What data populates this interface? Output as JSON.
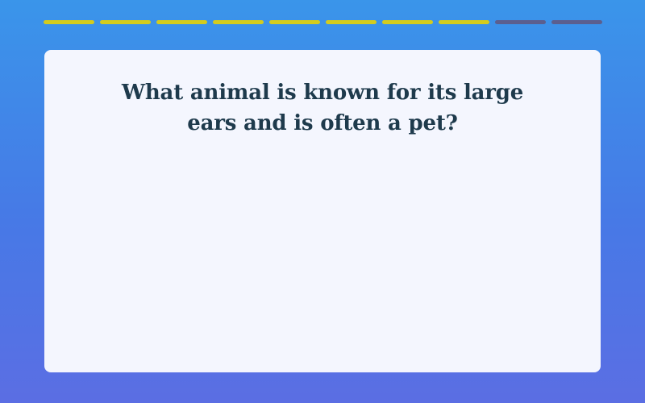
{
  "quiz": {
    "progress": {
      "total_steps": 10,
      "completed_steps": 8,
      "completed_color": "#d4cc1e",
      "remaining_color": "#5b5f8f"
    },
    "question": "What animal is known for its large ears and is often a pet?"
  },
  "theme": {
    "background_top": "#3a95ea",
    "background_bottom": "#5b6ee3",
    "card_background": "#f4f6fe",
    "text_color": "#1e3a4c"
  }
}
